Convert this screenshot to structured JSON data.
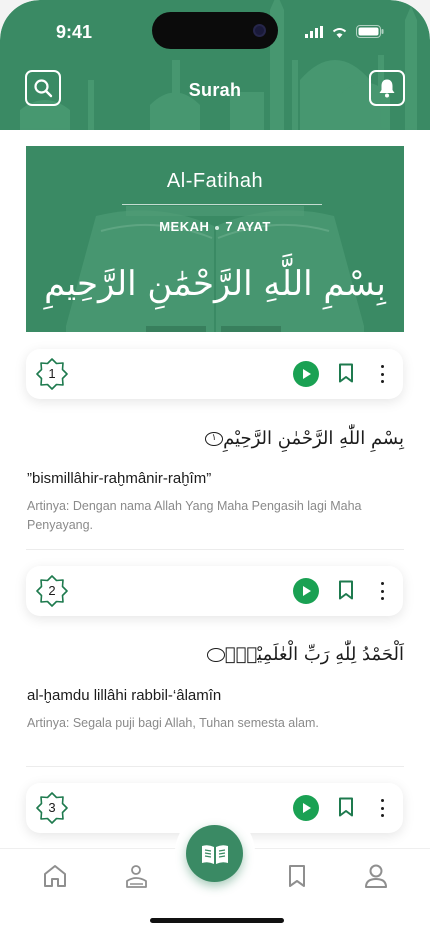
{
  "status_bar": {
    "time": "9:41"
  },
  "header": {
    "title": "Surah",
    "search_icon": "search-icon",
    "notification_icon": "bell-icon"
  },
  "banner": {
    "surah_name": "Al-Fatihah",
    "place": "MEKAH",
    "ayah_count": "7 AYAT",
    "basmalah": "بِسْمِ اللَّهِ الرَّحْمَٰنِ الرَّحِيمِ"
  },
  "verses": [
    {
      "number": "1",
      "arabic": "بِسْمِ اللّٰهِ الرَّحْمٰنِ الرَّحِيْمِ",
      "end_mark": "١",
      "transliteration": "”bismillâhir-raḫmânir-raḫîm”",
      "translation": "Artinya: Dengan nama Allah Yang Maha Pengasih lagi Maha Penyayang."
    },
    {
      "number": "2",
      "arabic": "اَلْحَمْدُ لِلّٰهِ رَبِّ الْعٰلَمِيْنَۙ",
      "end_mark": "",
      "transliteration": "al-ḫamdu lillâhi rabbil-‘âlamîn",
      "translation": "Artinya: Segala puji bagi Allah, Tuhan semesta alam."
    },
    {
      "number": "3"
    }
  ],
  "bottom_nav": {
    "items": [
      "home-icon",
      "reader-icon",
      "quran-book-icon",
      "bookmark-icon",
      "profile-icon"
    ]
  },
  "colors": {
    "primary": "#3a8a64",
    "play": "#1aa153",
    "accent_dark": "#1e7a4e"
  }
}
